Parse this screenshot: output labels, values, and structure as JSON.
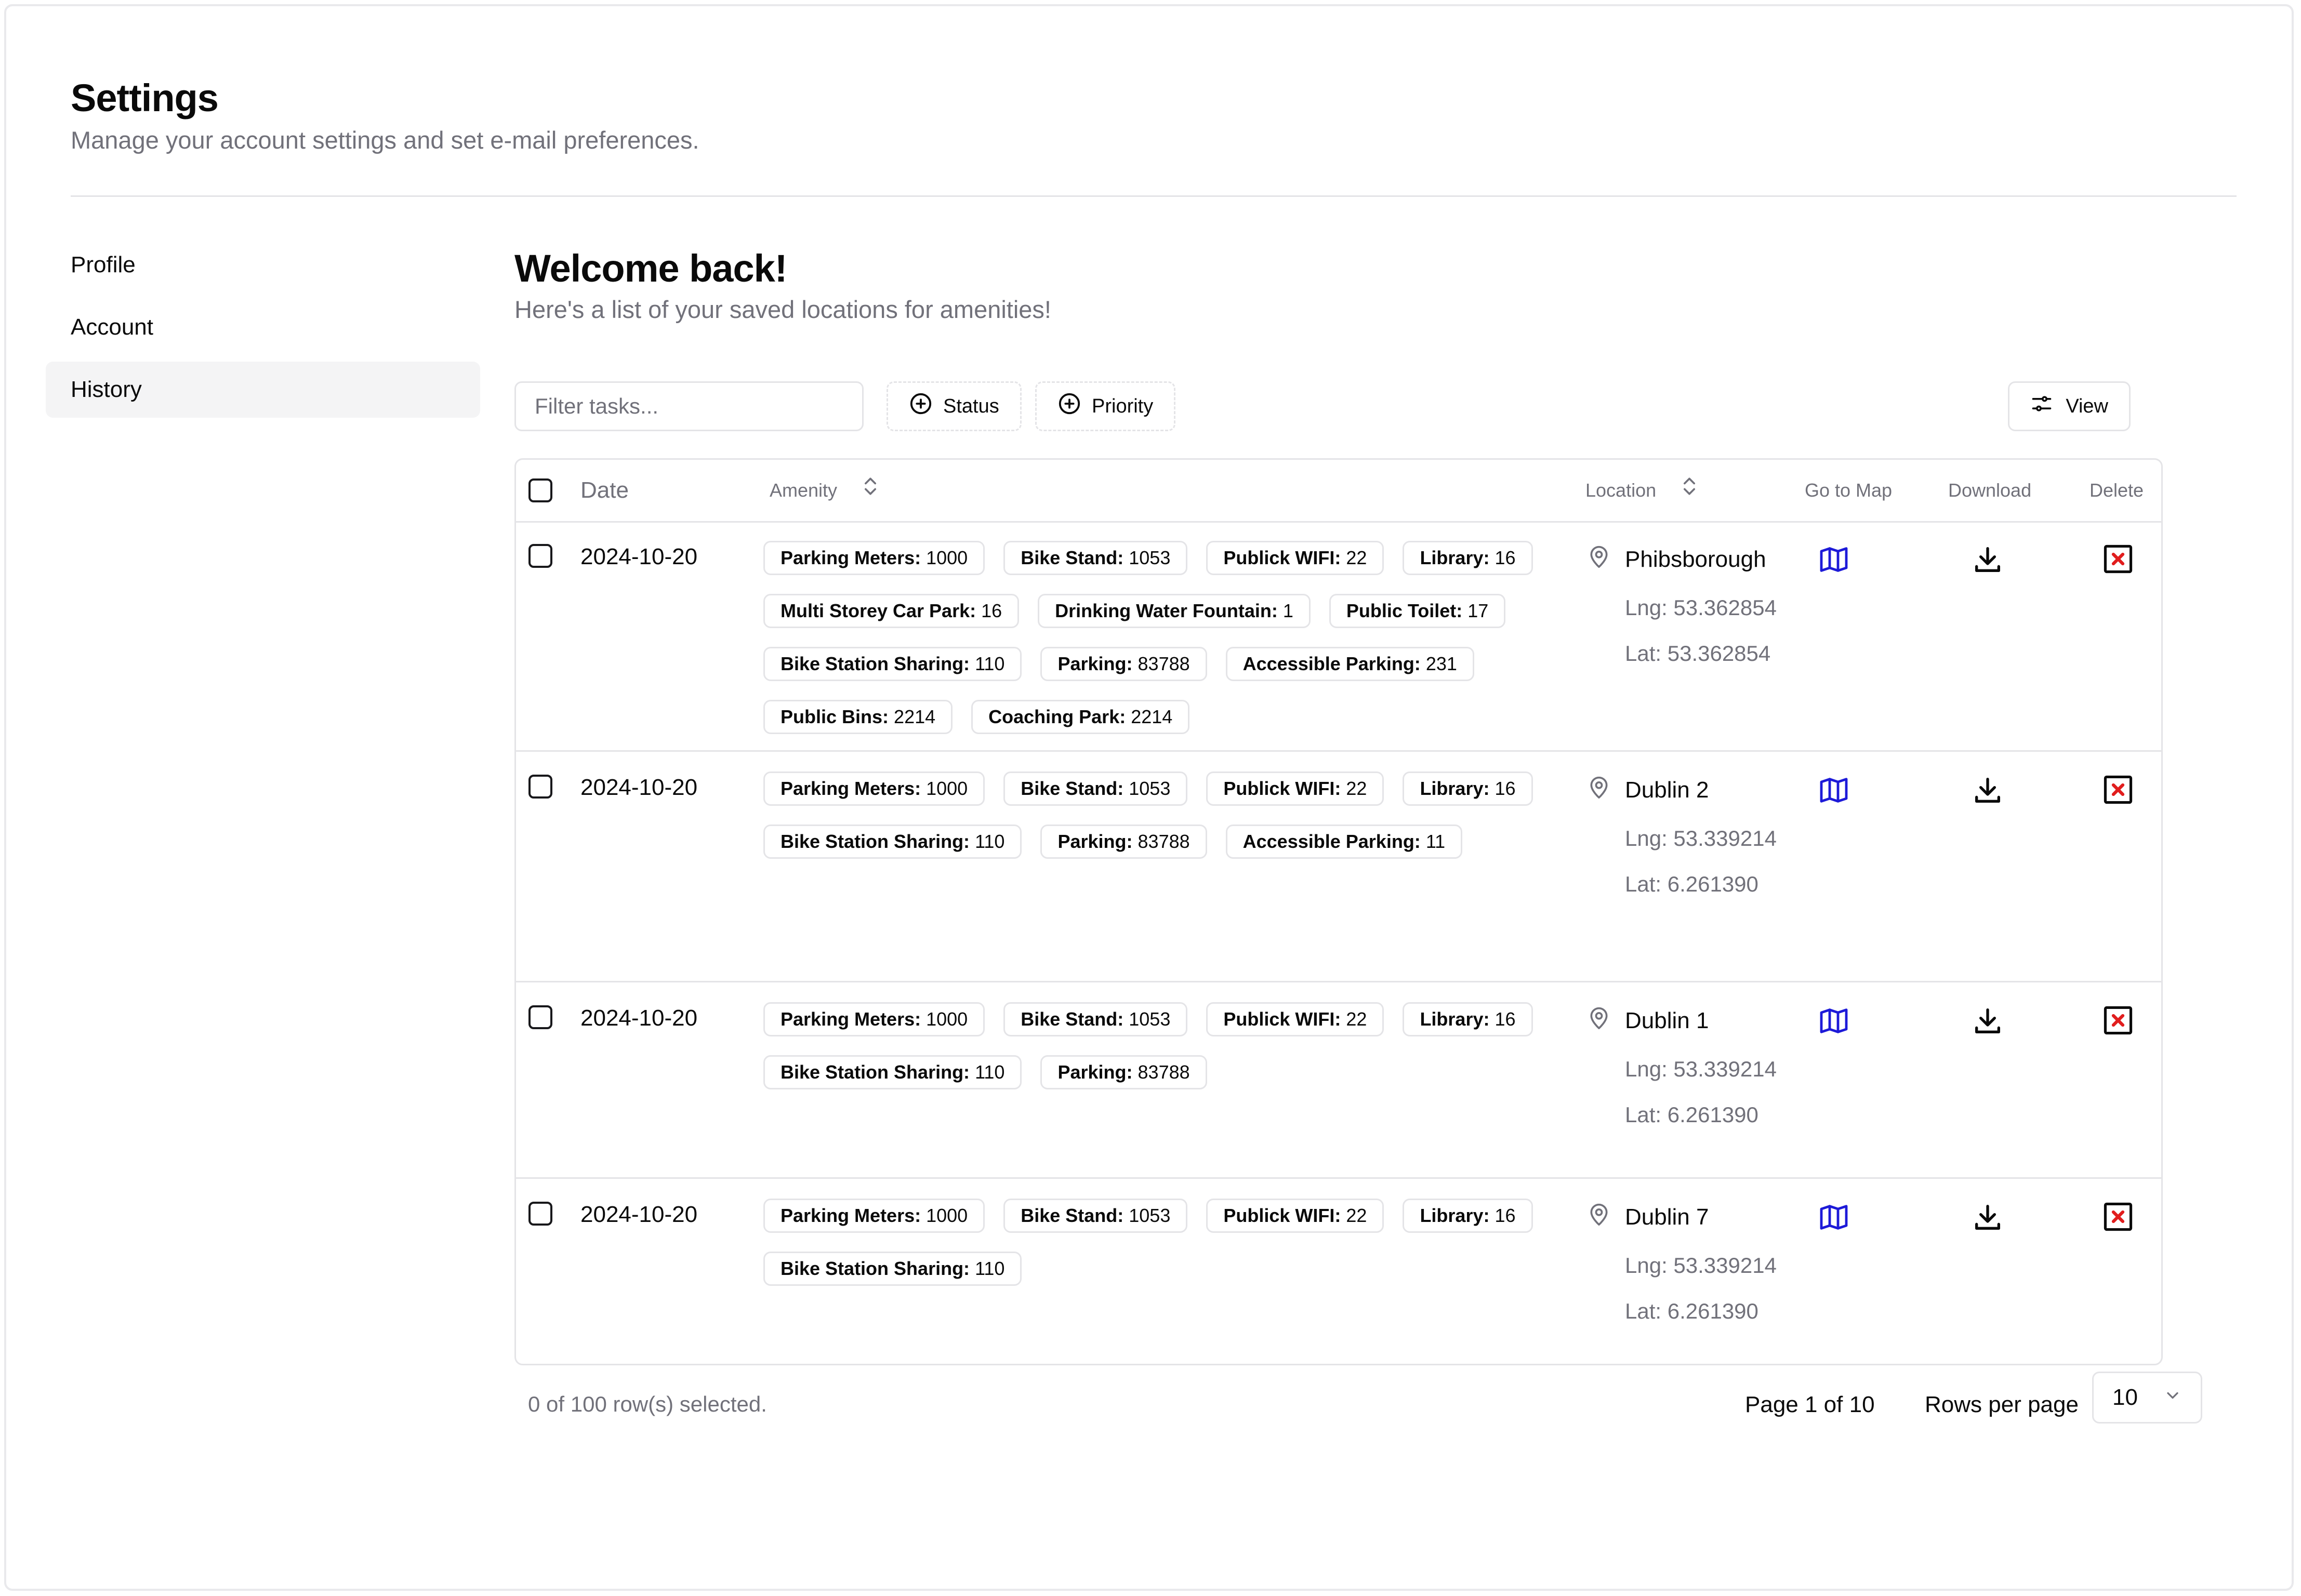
{
  "header": {
    "title": "Settings",
    "subtitle": "Manage your account settings and set e-mail preferences."
  },
  "sidebar": {
    "items": [
      {
        "label": "Profile"
      },
      {
        "label": "Account"
      },
      {
        "label": "History",
        "active": true
      }
    ]
  },
  "main": {
    "title": "Welcome back!",
    "subtitle": "Here's a list of your saved locations for amenities!"
  },
  "toolbar": {
    "filter_placeholder": "Filter tasks...",
    "status_label": "Status",
    "priority_label": "Priority",
    "view_label": "View"
  },
  "table": {
    "headers": {
      "date": "Date",
      "amenity": "Amenity",
      "location": "Location",
      "go_to_map": "Go to Map",
      "download": "Download",
      "delete": "Delete"
    },
    "rows": [
      {
        "date": "2024-10-20",
        "amenities": [
          {
            "name": "Parking Meters:",
            "count": "1000"
          },
          {
            "name": "Bike Stand:",
            "count": "1053"
          },
          {
            "name": "Publick WIFI:",
            "count": "22"
          },
          {
            "name": "Library:",
            "count": "16"
          },
          {
            "name": "Multi Storey Car Park:",
            "count": "16"
          },
          {
            "name": "Drinking Water Fountain:",
            "count": "1"
          },
          {
            "name": "Public Toilet:",
            "count": "17"
          },
          {
            "name": "Bike Station Sharing:",
            "count": "110"
          },
          {
            "name": "Parking:",
            "count": "83788"
          },
          {
            "name": "Accessible Parking:",
            "count": "231"
          },
          {
            "name": "Public Bins:",
            "count": "2214"
          },
          {
            "name": "Coaching Park:",
            "count": "2214"
          }
        ],
        "location": "Phibsborough",
        "lng": "Lng: 53.362854",
        "lat": "Lat: 53.362854"
      },
      {
        "date": "2024-10-20",
        "amenities": [
          {
            "name": "Parking Meters:",
            "count": "1000"
          },
          {
            "name": "Bike Stand:",
            "count": "1053"
          },
          {
            "name": "Publick WIFI:",
            "count": "22"
          },
          {
            "name": "Library:",
            "count": "16"
          },
          {
            "name": "Bike Station Sharing:",
            "count": "110"
          },
          {
            "name": "Parking:",
            "count": "83788"
          },
          {
            "name": "Accessible Parking:",
            "count": "11"
          }
        ],
        "location": "Dublin 2",
        "lng": "Lng: 53.339214",
        "lat": "Lat: 6.261390"
      },
      {
        "date": "2024-10-20",
        "amenities": [
          {
            "name": "Parking Meters:",
            "count": "1000"
          },
          {
            "name": "Bike Stand:",
            "count": "1053"
          },
          {
            "name": "Publick WIFI:",
            "count": "22"
          },
          {
            "name": "Library:",
            "count": "16"
          },
          {
            "name": "Bike Station Sharing:",
            "count": "110"
          },
          {
            "name": "Parking:",
            "count": "83788"
          }
        ],
        "location": "Dublin 1",
        "lng": "Lng: 53.339214",
        "lat": "Lat: 6.261390"
      },
      {
        "date": "2024-10-20",
        "amenities": [
          {
            "name": "Parking Meters:",
            "count": "1000"
          },
          {
            "name": "Bike Stand:",
            "count": "1053"
          },
          {
            "name": "Publick WIFI:",
            "count": "22"
          },
          {
            "name": "Library:",
            "count": "16"
          },
          {
            "name": "Bike Station Sharing:",
            "count": "110"
          }
        ],
        "location": "Dublin 7",
        "lng": "Lng: 53.339214",
        "lat": "Lat: 6.261390"
      }
    ]
  },
  "footer": {
    "selected_text": "0 of 100 row(s) selected.",
    "page_info": "Page 1 of 10",
    "rows_per_page_label": "Rows per page",
    "rows_per_page_value": "10"
  },
  "colors": {
    "map_icon": "#1d1ad8",
    "delete_icon": "#e11d1d",
    "border": "#e4e4e7",
    "muted_text": "#71717a"
  },
  "icons": {
    "location": "map-pin-icon",
    "go_to_map": "map-icon",
    "download": "download-icon",
    "delete": "close-box-icon",
    "sort": "chevron-up-down-icon",
    "add": "plus-circle-icon",
    "view": "sliders-icon"
  }
}
